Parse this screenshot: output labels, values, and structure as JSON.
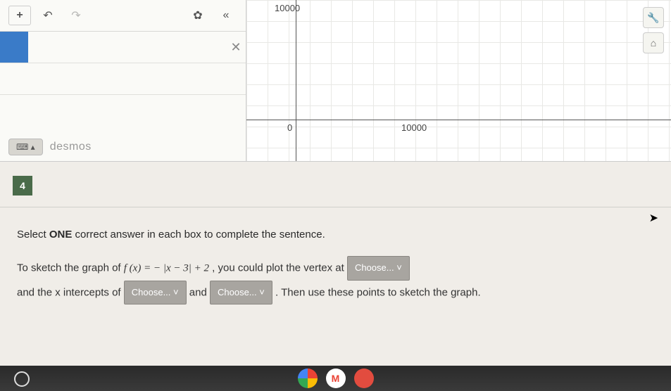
{
  "calc": {
    "plus": "+",
    "undo": "↶",
    "redo": "↷",
    "gear": "✿",
    "collapse": "«",
    "close_x": "✕",
    "keypad": "⌨ ▴",
    "brand": "desmos"
  },
  "graph": {
    "tick_y": "10000",
    "origin": "0",
    "tick_x": "10000",
    "wrench": "🔧",
    "home": "⌂"
  },
  "question": {
    "number": "4",
    "instructions_a": "Select ",
    "instructions_b": "ONE",
    "instructions_c": " correct answer in each box to complete the sentence.",
    "line1_a": "To sketch the graph of ",
    "line1_fx": "f (x) = − |x − 3| + 2",
    "line1_b": " , you could plot the vertex at ",
    "choose": "Choose... ˅",
    "line2_a": "and the x intercepts of ",
    "line2_b": " and ",
    "line2_c": " .  Then use these points to sketch the graph."
  },
  "chart_data": {
    "type": "line",
    "title": "",
    "xlabel": "",
    "ylabel": "",
    "x_ticks": [
      0,
      10000
    ],
    "y_ticks": [
      0,
      10000
    ],
    "series": []
  }
}
